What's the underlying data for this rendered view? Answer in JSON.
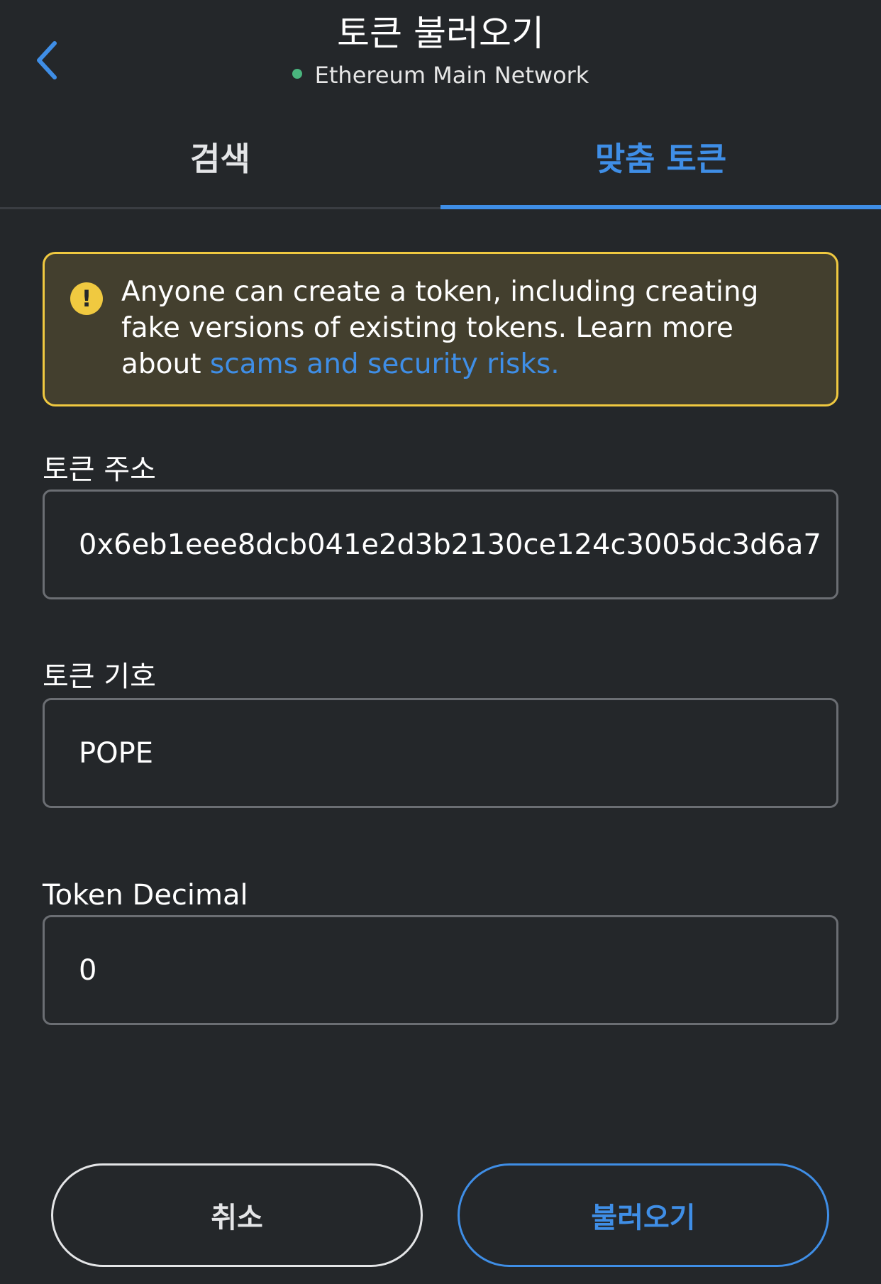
{
  "header": {
    "back_icon": "chevron-left-icon",
    "title": "토큰 불러오기",
    "network_name": "Ethereum Main Network",
    "network_status_color": "#4ab57e"
  },
  "tabs": [
    {
      "label": "검색",
      "active": false
    },
    {
      "label": "맞춤 토큰",
      "active": true
    }
  ],
  "warning": {
    "icon": "exclamation-icon",
    "text": "Anyone can create a token, including creating fake versions of existing tokens. Learn more about ",
    "link_text": "scams and security risks."
  },
  "fields": {
    "address": {
      "label": "토큰 주소",
      "value": "0x6eb1eee8dcb041e2d3b2130ce124c3005dc3d6a7"
    },
    "symbol": {
      "label": "토큰 기호",
      "value": "POPE"
    },
    "decimal": {
      "label": "Token Decimal",
      "value": "0"
    }
  },
  "buttons": {
    "cancel_label": "취소",
    "import_label": "불러오기"
  },
  "colors": {
    "background": "#24272a",
    "accent": "#3f8ee6",
    "warning_border": "#f0c940",
    "warning_background": "#433f2e"
  }
}
